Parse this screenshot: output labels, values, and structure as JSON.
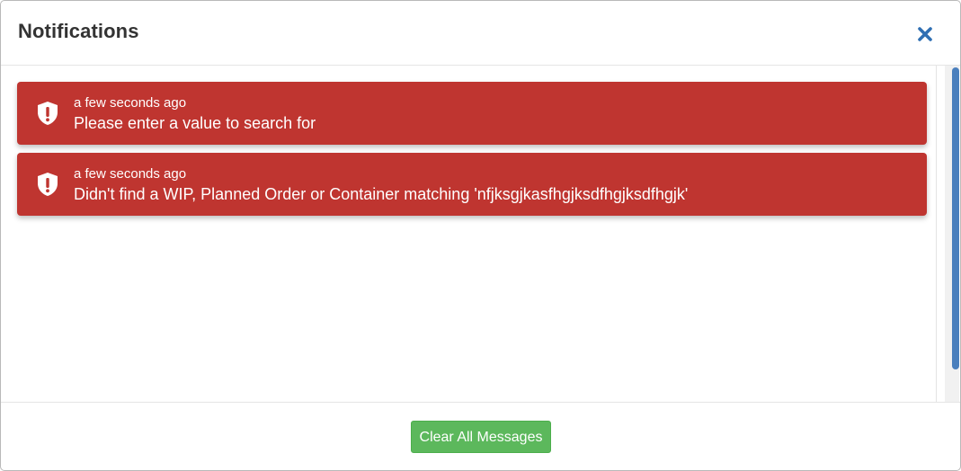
{
  "dialog": {
    "title": "Notifications",
    "close_icon": "close-icon"
  },
  "notifications": [
    {
      "time": "a few seconds ago",
      "message": "Please enter a value to search for",
      "icon": "shield-alert-icon",
      "color": "#bf3530"
    },
    {
      "time": "a few seconds ago",
      "message": "Didn't find a WIP, Planned Order or Container matching 'nfjksgjkasfhgjksdfhgjksdfhgjk'",
      "icon": "shield-alert-icon",
      "color": "#bf3530"
    }
  ],
  "footer": {
    "clear_all_label": "Clear All Messages",
    "clear_all_color": "#5cb85c"
  },
  "colors": {
    "accent": "#2f6fb3",
    "scrollbar": "#4a7fbd"
  }
}
